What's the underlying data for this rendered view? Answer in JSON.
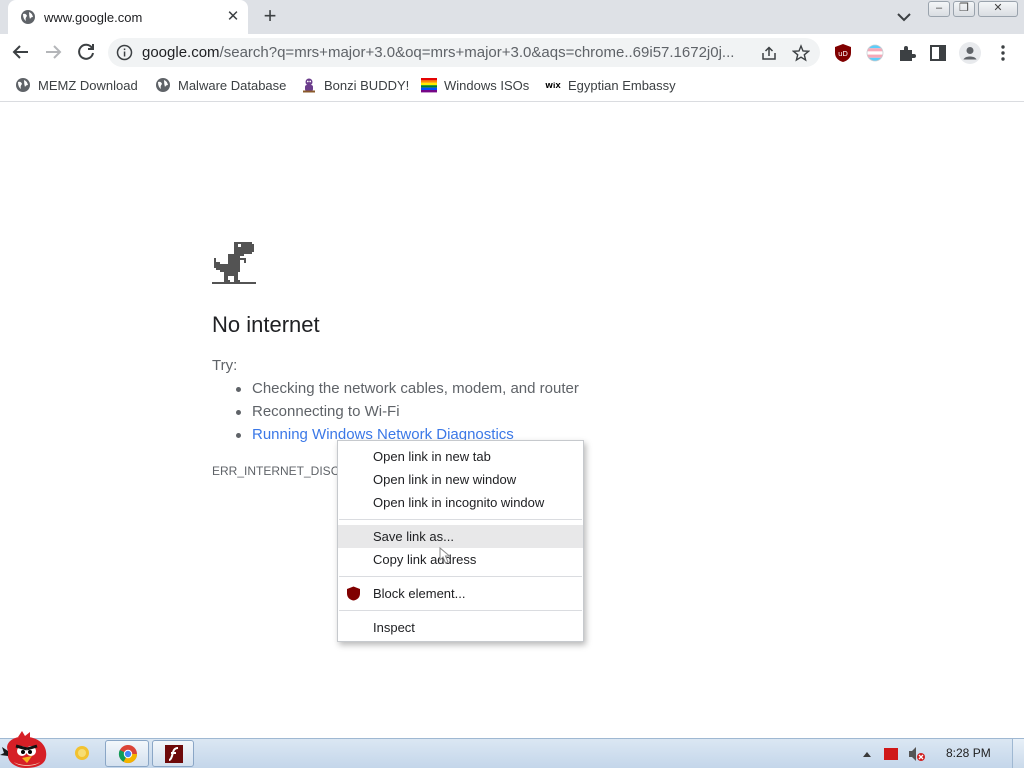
{
  "tab": {
    "title": "www.google.com",
    "close_glyph": "✕",
    "favicon": "globe-icon"
  },
  "newtab_glyph": "+",
  "window": {
    "minimize": "–",
    "restore": "❐",
    "close": "✕"
  },
  "omnibox": {
    "host": "google.com",
    "path": "/search?q=mrs+major+3.0&oq=mrs+major+3.0&aqs=chrome..69i57.1672j0j..."
  },
  "bookmarks": [
    {
      "label": "MEMZ Download",
      "icon": "globe-icon"
    },
    {
      "label": "Malware Database",
      "icon": "globe-icon"
    },
    {
      "label": "Bonzi BUDDY!",
      "icon": "bonzi-icon"
    },
    {
      "label": "Windows ISOs",
      "icon": "rainbow-flag-icon"
    },
    {
      "label": "Egyptian Embassy",
      "icon": "wix-icon"
    }
  ],
  "wix_text": "WiX",
  "error_page": {
    "headline": "No internet",
    "try_label": "Try:",
    "suggestions": [
      "Checking the network cables, modem, and router",
      "Reconnecting to Wi-Fi",
      "Running Windows Network Diagnostics"
    ],
    "error_code": "ERR_INTERNET_DISCONNECTED"
  },
  "context_menu": {
    "items": [
      "Open link in new tab",
      "Open link in new window",
      "Open link in incognito window",
      "Save link as...",
      "Copy link address",
      "Block element...",
      "Inspect"
    ],
    "hovered": "Save link as..."
  },
  "ublock_label": "uD",
  "taskbar": {
    "clock": "8:28 PM"
  },
  "colors": {
    "link": "#3b78e7",
    "ublock": "#800000",
    "taskbar": "#c4d6ea"
  }
}
